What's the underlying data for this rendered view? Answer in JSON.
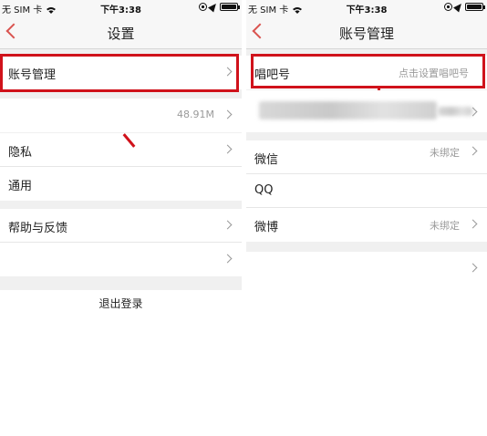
{
  "status_bar": {
    "carrier": "无 SIM 卡",
    "time": "下午3:38"
  },
  "left_screen": {
    "title": "设置",
    "items": [
      {
        "label": "账号管理",
        "value": ""
      },
      {
        "label": "",
        "value": "48.91M"
      },
      {
        "label": "隐私",
        "value": ""
      },
      {
        "label": "通用",
        "value": ""
      },
      {
        "label": "帮助与反馈",
        "value": ""
      },
      {
        "label": "",
        "value": ""
      }
    ],
    "logout_label": "退出登录"
  },
  "right_screen": {
    "title": "账号管理",
    "items": [
      {
        "label": "唱吧号",
        "value": "点击设置唱吧号"
      },
      {
        "label": "微信",
        "value": "未绑定"
      },
      {
        "label": "QQ",
        "value": ""
      },
      {
        "label": "微博",
        "value": "未绑定"
      },
      {
        "label": "",
        "value": ""
      }
    ]
  },
  "colors": {
    "accent": "#d9534f",
    "highlight_box": "#d0121b",
    "background": "#f0f0f0"
  }
}
